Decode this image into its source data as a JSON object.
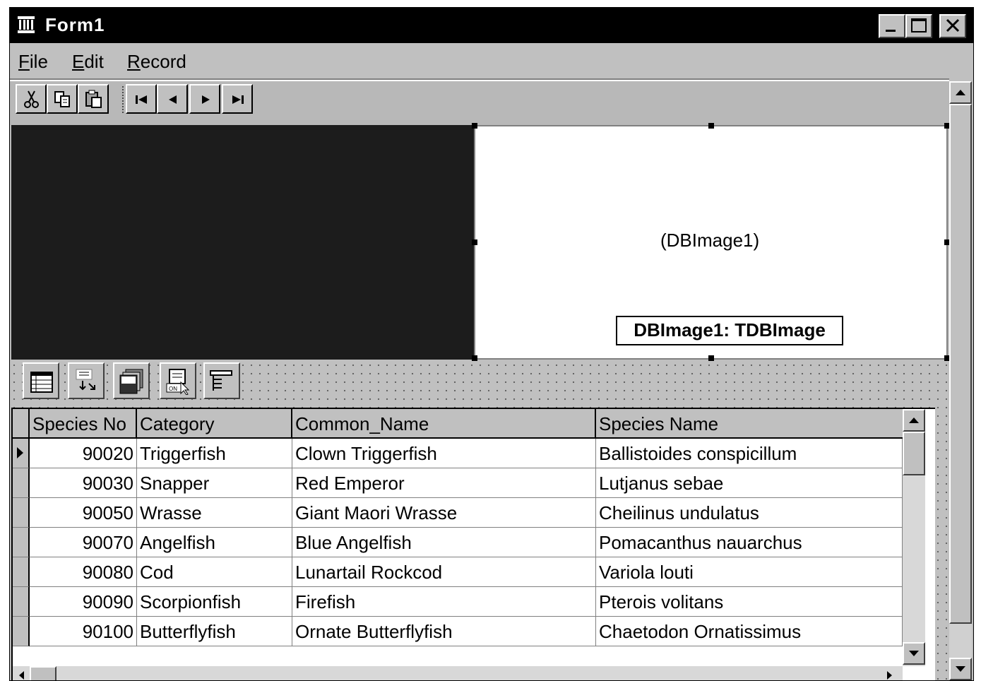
{
  "window": {
    "title": "Form1",
    "buttons": {
      "minimize": "_",
      "maximize": "□",
      "close": "✕"
    }
  },
  "menu": [
    {
      "label": "File",
      "accel": "F",
      "rest": "ile"
    },
    {
      "label": "Edit",
      "accel": "E",
      "rest": "dit"
    },
    {
      "label": "Record",
      "accel": "R",
      "rest": "ecord"
    }
  ],
  "toolbar": {
    "buttons": [
      "cut-icon",
      "copy-icon",
      "paste-icon",
      "first-record-icon",
      "prior-record-icon",
      "next-record-icon",
      "last-record-icon"
    ]
  },
  "image_panel": {
    "placeholder": "(DBImage1)",
    "hint": "DBImage1: TDBImage"
  },
  "components": [
    "table-icon",
    "datasource-icon",
    "stack-icon",
    "form-wizard-icon",
    "query-icon"
  ],
  "grid": {
    "columns": [
      "Species No",
      "Category",
      "Common_Name",
      "Species Name"
    ],
    "rows": [
      [
        "90020",
        "Triggerfish",
        "Clown Triggerfish",
        "Ballistoides conspicillum"
      ],
      [
        "90030",
        "Snapper",
        "Red Emperor",
        "Lutjanus sebae"
      ],
      [
        "90050",
        "Wrasse",
        "Giant Maori Wrasse",
        "Cheilinus undulatus"
      ],
      [
        "90070",
        "Angelfish",
        "Blue Angelfish",
        "Pomacanthus nauarchus"
      ],
      [
        "90080",
        "Cod",
        "Lunartail Rockcod",
        "Variola louti"
      ],
      [
        "90090",
        "Scorpionfish",
        "Firefish",
        "Pterois volitans"
      ],
      [
        "90100",
        "Butterflyfish",
        "Ornate Butterflyfish",
        "Chaetodon Ornatissimus"
      ]
    ],
    "current_row": 0
  }
}
